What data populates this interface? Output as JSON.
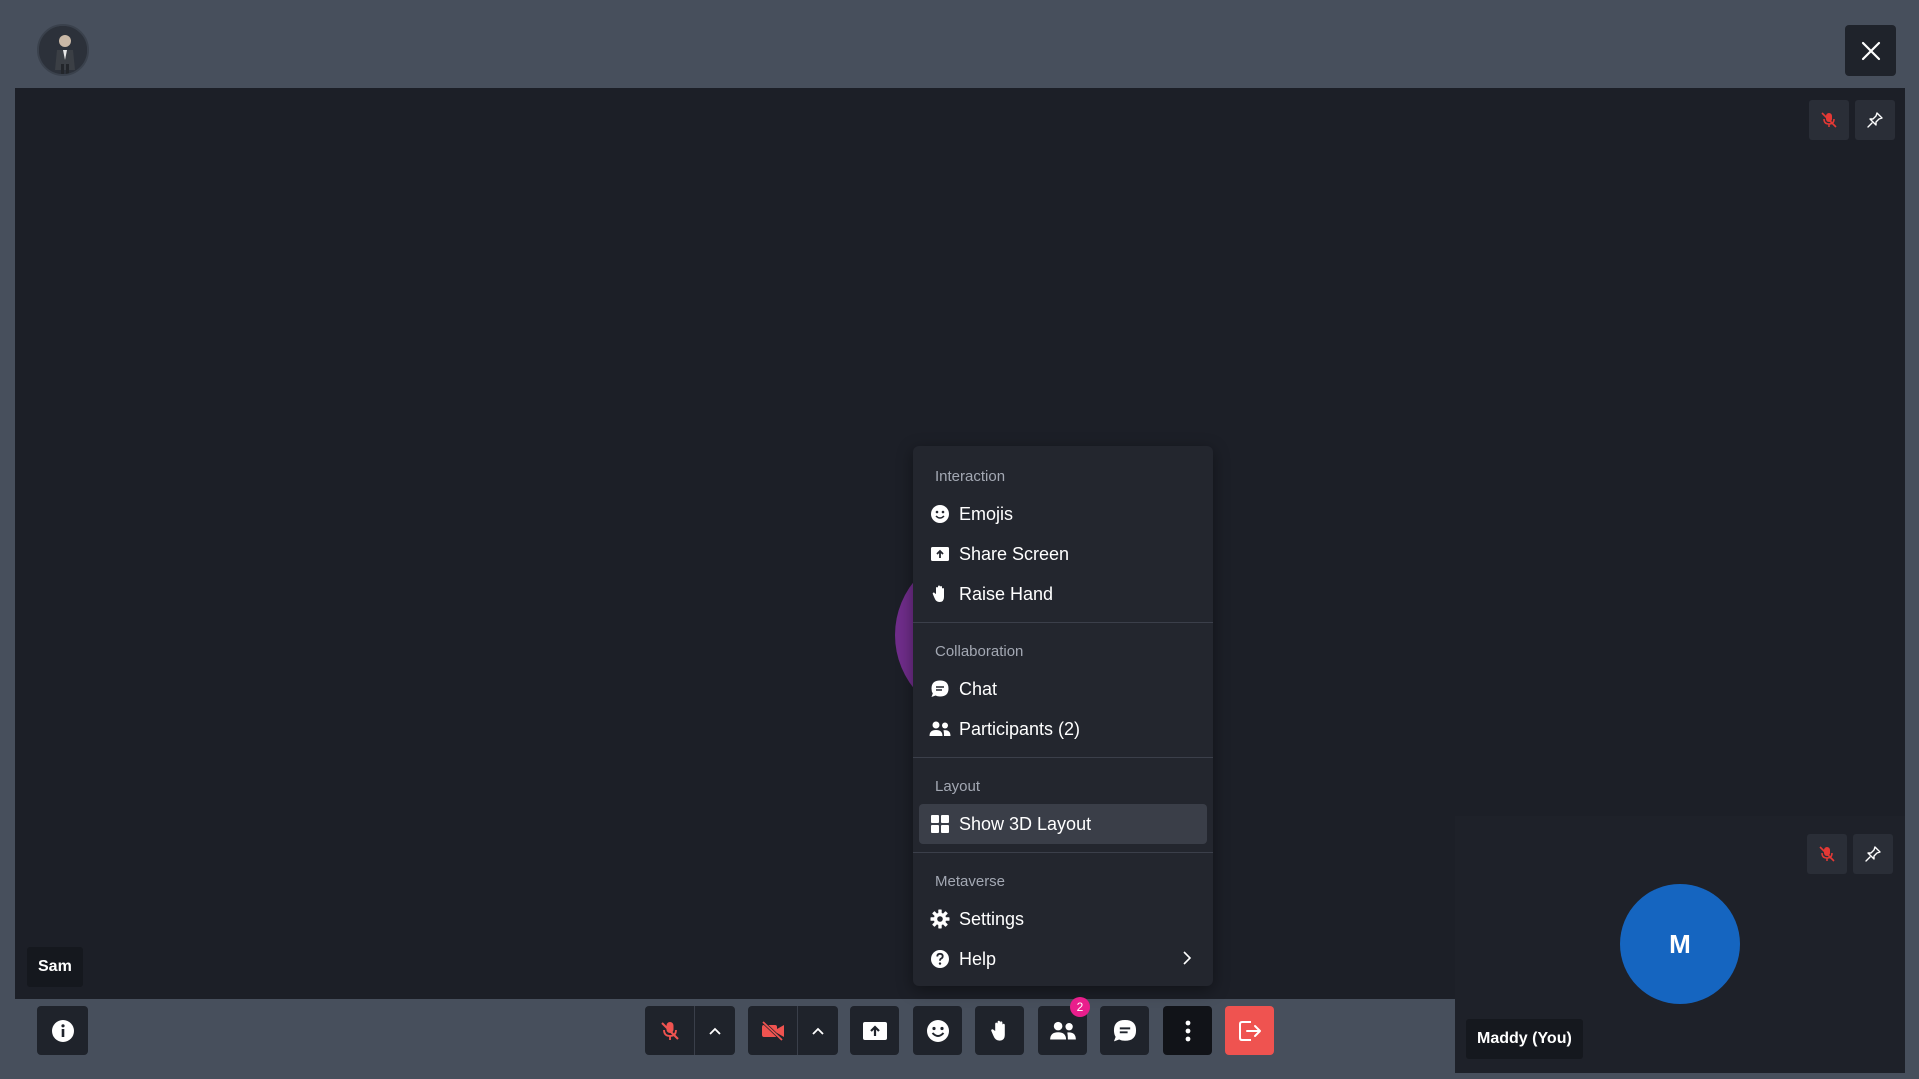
{
  "header": {
    "close_label": "close"
  },
  "remote": {
    "name": "Sam",
    "avatar_color": "#6f2d8a"
  },
  "self": {
    "name": "Maddy (You)",
    "initial": "M",
    "avatar_color": "#1565c0"
  },
  "menu": {
    "sections": [
      {
        "heading": "Interaction",
        "items": [
          {
            "label": "Emojis",
            "icon": "smile-icon"
          },
          {
            "label": "Share Screen",
            "icon": "share-screen-icon"
          },
          {
            "label": "Raise Hand",
            "icon": "hand-icon"
          }
        ]
      },
      {
        "heading": "Collaboration",
        "items": [
          {
            "label": "Chat",
            "icon": "chat-icon"
          },
          {
            "label": "Participants (2)",
            "icon": "participants-icon"
          }
        ]
      },
      {
        "heading": "Layout",
        "items": [
          {
            "label": "Show 3D Layout",
            "icon": "grid-icon",
            "active": true
          }
        ]
      },
      {
        "heading": "Metaverse",
        "items": [
          {
            "label": "Settings",
            "icon": "gear-icon"
          },
          {
            "label": "Help",
            "icon": "help-icon",
            "submenu": true
          }
        ]
      }
    ]
  },
  "toolbar": {
    "participants_badge": "2",
    "end_call_color": "#ef5350",
    "muted_color": "#ef5350"
  }
}
